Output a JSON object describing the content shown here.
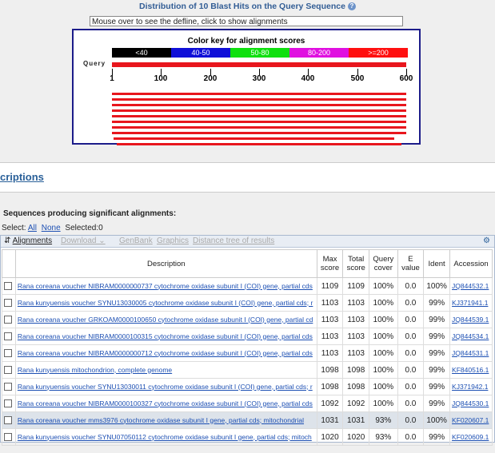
{
  "header": {
    "title": "Distribution of 10 Blast Hits on the Query Sequence",
    "defline": "Mouse over to see the defline, click to show alignments"
  },
  "color_key": {
    "title": "Color key for alignment scores",
    "ranges": [
      {
        "label": "<40",
        "color": "#000000"
      },
      {
        "label": "40-50",
        "color": "#1010d8"
      },
      {
        "label": "50-80",
        "color": "#10e010"
      },
      {
        "label": "80-200",
        "color": "#e010e0"
      },
      {
        "label": ">=200",
        "color": "#ff1010"
      }
    ]
  },
  "query": {
    "label": "Query",
    "ticks": [
      "1",
      "100",
      "200",
      "300",
      "400",
      "500",
      "600"
    ],
    "length": 600
  },
  "hits_graph": {
    "hit_color": "#e8161d",
    "hit_spans": [
      [
        1,
        600
      ],
      [
        1,
        600
      ],
      [
        1,
        600
      ],
      [
        1,
        600
      ],
      [
        1,
        600
      ],
      [
        1,
        600
      ],
      [
        1,
        600
      ],
      [
        1,
        600
      ],
      [
        5,
        575
      ],
      [
        10,
        590
      ]
    ]
  },
  "section": {
    "descriptions_label": "criptions"
  },
  "sequences_title": "Sequences producing significant alignments:",
  "select": {
    "label": "Select:",
    "all": "All",
    "none": "None",
    "selected": "Selected:0"
  },
  "toolbar": {
    "alignments": "Alignments",
    "download": "Download",
    "genbank": "GenBank",
    "graphics": "Graphics",
    "distance_tree": "Distance tree of results"
  },
  "table": {
    "headers": [
      "Description",
      "Max score",
      "Total score",
      "Query cover",
      "E value",
      "Ident",
      "Accession"
    ],
    "rows": [
      {
        "desc": "Rana coreana voucher NIBRAM0000000737 cytochrome oxidase subunit I (COI) gene, partial cds",
        "max": "1109",
        "total": "1109",
        "cover": "100%",
        "e": "0.0",
        "ident": "100%",
        "acc": "JQ844532.1"
      },
      {
        "desc": "Rana kunyuensis voucher SYNU13030005 cytochrome oxidase subunit I (COI) gene, partial cds; r",
        "max": "1103",
        "total": "1103",
        "cover": "100%",
        "e": "0.0",
        "ident": "99%",
        "acc": "KJ371941.1"
      },
      {
        "desc": "Rana coreana voucher GRKOAM0000100650 cytochrome oxidase subunit I (COI) gene, partial cd",
        "max": "1103",
        "total": "1103",
        "cover": "100%",
        "e": "0.0",
        "ident": "99%",
        "acc": "JQ844539.1"
      },
      {
        "desc": "Rana coreana voucher NIBRAM0000100315 cytochrome oxidase subunit I (COI) gene, partial cds",
        "max": "1103",
        "total": "1103",
        "cover": "100%",
        "e": "0.0",
        "ident": "99%",
        "acc": "JQ844534.1"
      },
      {
        "desc": "Rana coreana voucher NIBRAM0000000712 cytochrome oxidase subunit I (COI) gene, partial cds",
        "max": "1103",
        "total": "1103",
        "cover": "100%",
        "e": "0.0",
        "ident": "99%",
        "acc": "JQ844531.1"
      },
      {
        "desc": "Rana kunyuensis mitochondrion, complete genome",
        "max": "1098",
        "total": "1098",
        "cover": "100%",
        "e": "0.0",
        "ident": "99%",
        "acc": "KF840516.1"
      },
      {
        "desc": "Rana kunyuensis voucher SYNU13030011 cytochrome oxidase subunit I (COI) gene, partial cds; r",
        "max": "1098",
        "total": "1098",
        "cover": "100%",
        "e": "0.0",
        "ident": "99%",
        "acc": "KJ371942.1"
      },
      {
        "desc": "Rana coreana voucher NIBRAM0000100327 cytochrome oxidase subunit I (COI) gene, partial cds",
        "max": "1092",
        "total": "1092",
        "cover": "100%",
        "e": "0.0",
        "ident": "99%",
        "acc": "JQ844530.1"
      },
      {
        "desc": "Rana coreana voucher mms3976 cytochrome oxidase subunit I gene, partial cds; mitochondrial",
        "max": "1031",
        "total": "1031",
        "cover": "93%",
        "e": "0.0",
        "ident": "100%",
        "acc": "KF020607.1"
      },
      {
        "desc": "Rana kunyuensis voucher SYNU07050112 cytochrome oxidase subunit I gene, partial cds; mitoch",
        "max": "1020",
        "total": "1020",
        "cover": "93%",
        "e": "0.0",
        "ident": "99%",
        "acc": "KF020609.1"
      }
    ],
    "highlighted_row": 8
  }
}
